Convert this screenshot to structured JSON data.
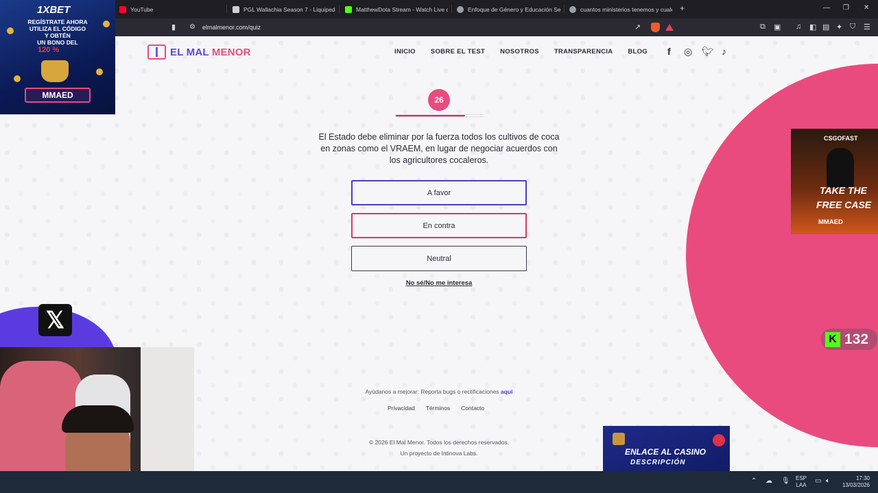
{
  "browser": {
    "tabs": [
      {
        "title": "YouTube",
        "favicon_color": "#ff0033"
      },
      {
        "title": "PGL Wallachia Season 7 - Liquipedia",
        "favicon_color": "#cfcfd4"
      },
      {
        "title": "MatthewDota Stream - Watch Live o",
        "favicon_color": "#53fc18"
      },
      {
        "title": "Enfoque de Género y Educación Sex",
        "favicon_color": "#9aa0a6"
      },
      {
        "title": "cuantos ministerios tenemos y cuale",
        "favicon_color": "#9aa0a6"
      }
    ],
    "new_tab": "+",
    "url": "elmalmenor.com/quiz"
  },
  "site": {
    "logo_text_1": "EL MAL",
    "logo_text_2": " MENOR",
    "nav": [
      "INICIO",
      "SOBRE EL TEST",
      "NOSOTROS",
      "TRANSPARENCIA",
      "BLOG"
    ],
    "social_icons": [
      "facebook-icon",
      "instagram-icon",
      "twitter-icon",
      "tiktok-icon"
    ]
  },
  "quiz": {
    "question_number": "26",
    "progress_fraction": 0.8,
    "question": "El Estado debe eliminar por la fuerza todos los cultivos de coca en zonas como el VRAEM, en lugar de negociar acuerdos con los agricultores cocaleros.",
    "options": {
      "favor": "A favor",
      "contra": "En contra",
      "neutral": "Neutral"
    },
    "skip": "No sé/No me interesa"
  },
  "footer": {
    "help_text": "Ayúdanos a mejorar: Reporta bugs o rectificaciones ",
    "help_link": "aquí",
    "links": [
      "Privacidad",
      "Términos",
      "Contacto"
    ],
    "copyright": "© 2026 El Mal Menor. Todos los derechos reservados.",
    "project": "Un proyecto de Intinova Labs."
  },
  "overlays": {
    "ad_topleft": {
      "brand": "1XBET",
      "line1": "REGÍSTRATE AHORA",
      "line2": "UTILIZA EL CÓDIGO",
      "line3": "Y OBTÉN",
      "line4": "UN BONO DEL",
      "percent": "120 %",
      "code": "MMAED"
    },
    "ad_right": {
      "brand": "CSGOFAST",
      "line1": "TAKE THE",
      "line2": "FREE CASE",
      "code": "MMAED"
    },
    "kick_count": "132",
    "casino_line1": "ENLACE AL CASINO",
    "casino_line2": "DESCRIPCIÓN"
  },
  "taskbar": {
    "lang_1": "ESP",
    "lang_2": "LAA",
    "time": "17:30",
    "date": "13/03/2026"
  },
  "colors": {
    "brand_purple": "#5a46d8",
    "brand_pink": "#e94b7f"
  }
}
